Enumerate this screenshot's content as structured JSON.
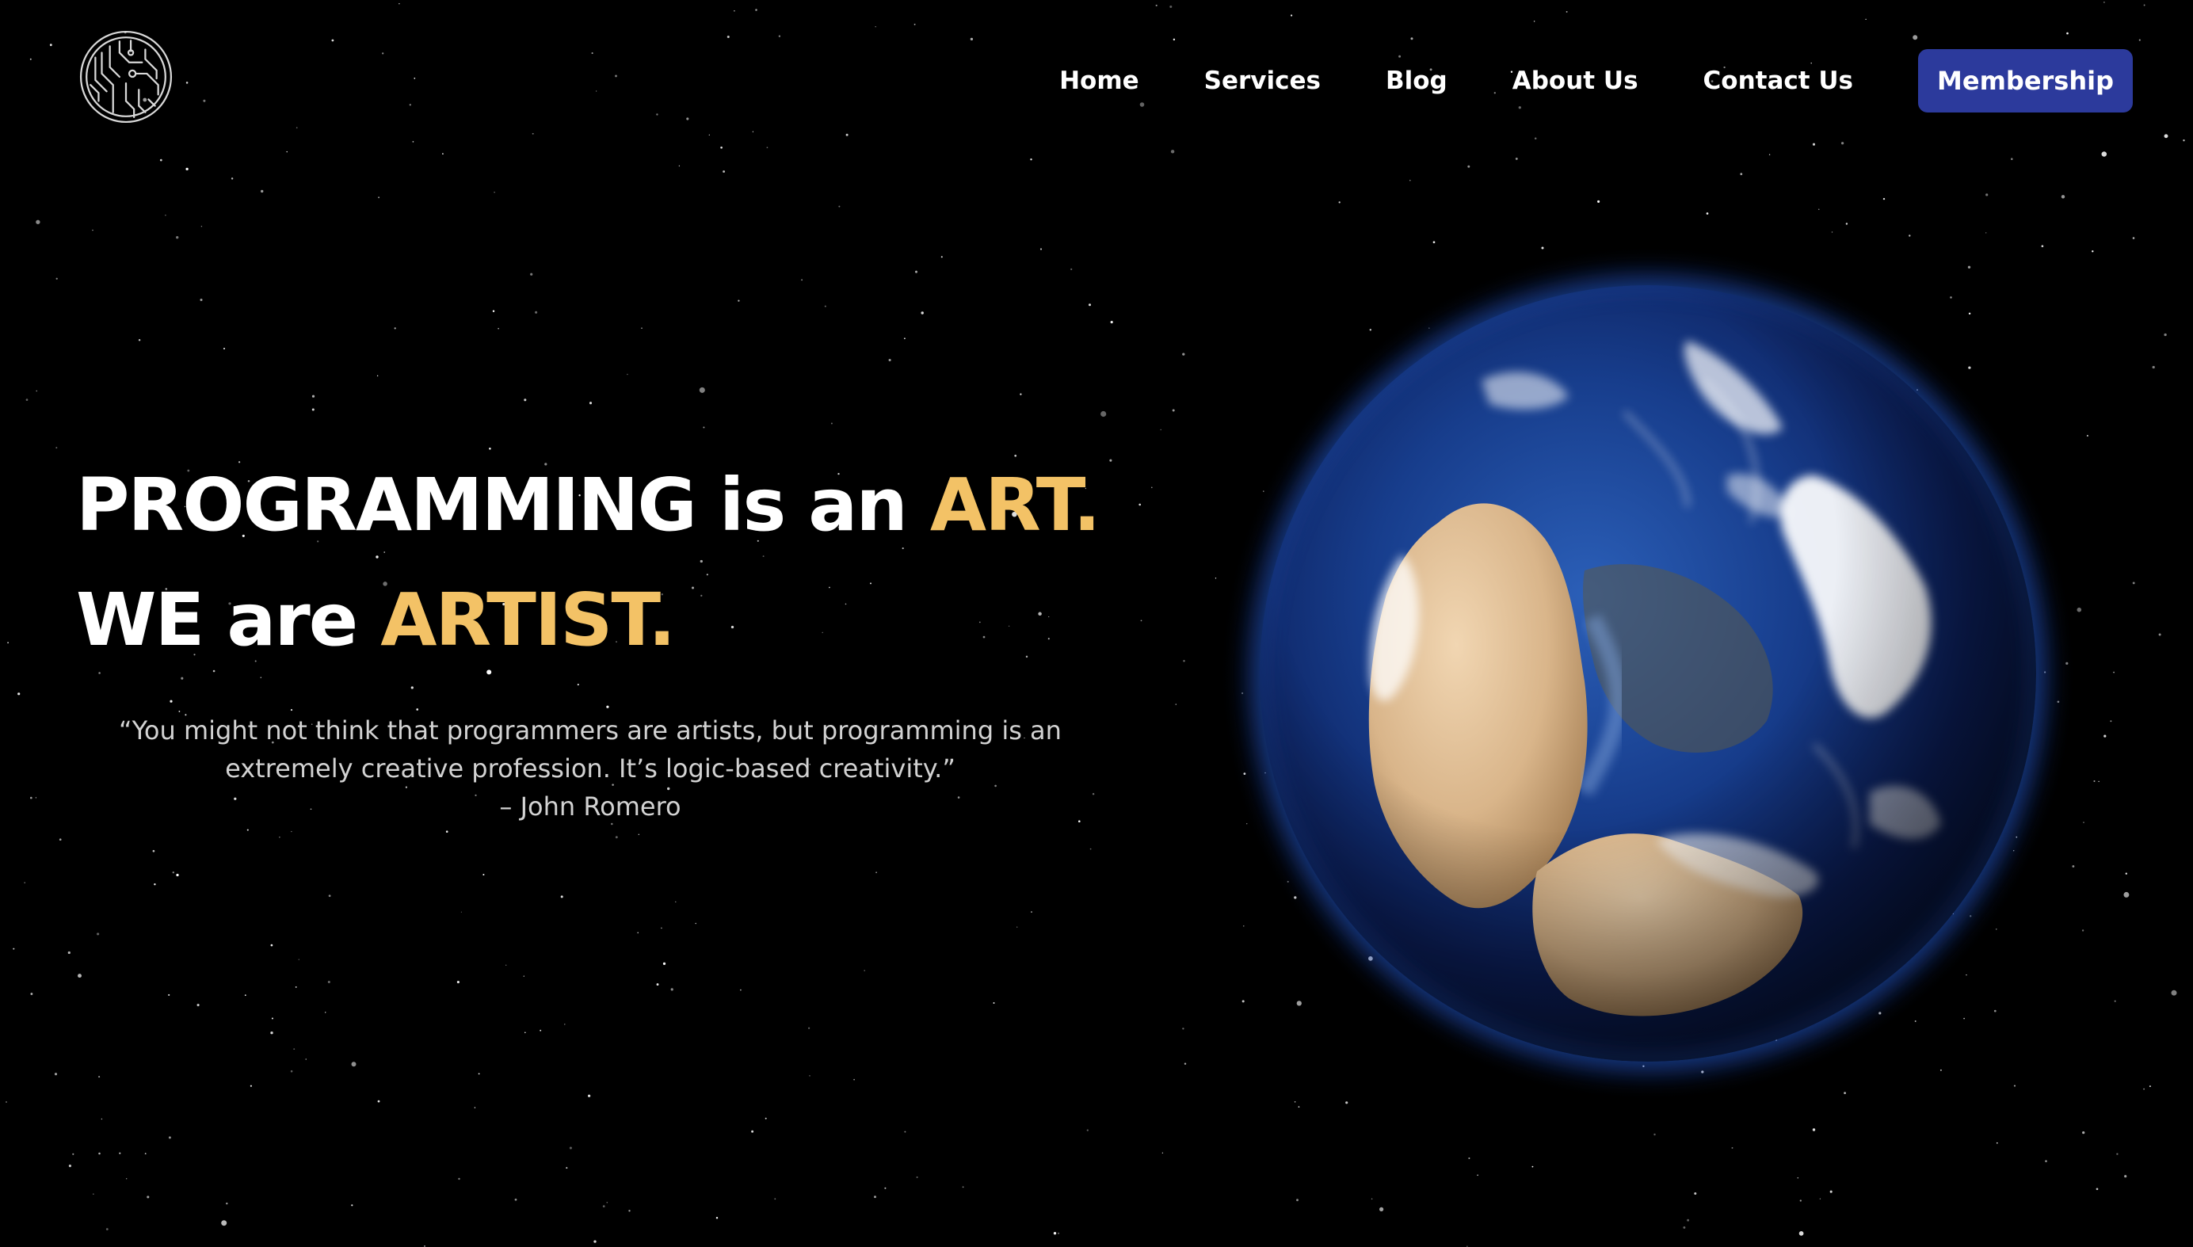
{
  "colors": {
    "background": "#000000",
    "accent": "#f3c266",
    "button": "#2c3a9c",
    "quote_text": "#d2d2d2"
  },
  "logo": {
    "icon": "circuit-logo-icon"
  },
  "nav": {
    "items": [
      {
        "label": "Home"
      },
      {
        "label": "Services"
      },
      {
        "label": "Blog"
      },
      {
        "label": "About Us"
      },
      {
        "label": "Contact Us"
      }
    ],
    "cta_label": "Membership"
  },
  "hero": {
    "line1_part1": "PROGRAMMING is an ",
    "line1_accent": "ART.",
    "line2_part1": "WE are ",
    "line2_accent": "ARTIST."
  },
  "quote": {
    "text_line1": "“You might not think that programmers are artists, but programming is an",
    "text_line2": "extremely creative profession. It’s logic-based creativity.”",
    "author": "– John Romero"
  },
  "planet": {
    "icon": "earth-globe-image"
  }
}
